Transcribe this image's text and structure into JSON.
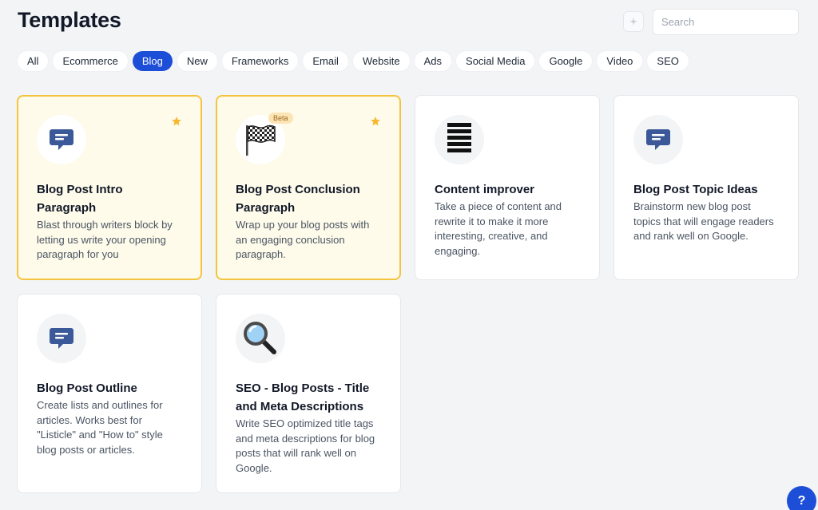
{
  "header": {
    "title": "Templates",
    "search_placeholder": "Search"
  },
  "filters": [
    "All",
    "Ecommerce",
    "Blog",
    "New",
    "Frameworks",
    "Email",
    "Website",
    "Ads",
    "Social Media",
    "Google",
    "Video",
    "SEO"
  ],
  "active_filter": "Blog",
  "cards": [
    {
      "title": "Blog Post Intro Paragraph",
      "description": "Blast through writers block by letting us write your opening paragraph for you",
      "icon": "speech-bubble-icon",
      "favorite": true,
      "highlighted": true
    },
    {
      "title": "Blog Post Conclusion Paragraph",
      "description": "Wrap up your blog posts with an engaging conclusion paragraph.",
      "icon": "checkered-flag-icon",
      "favorite": true,
      "highlighted": true,
      "badge": "Beta"
    },
    {
      "title": "Content improver",
      "description": "Take a piece of content and rewrite it to make it more interesting, creative, and engaging.",
      "icon": "text-lines-icon",
      "favorite": false,
      "highlighted": false
    },
    {
      "title": "Blog Post Topic Ideas",
      "description": "Brainstorm new blog post topics that will engage readers and rank well on Google.",
      "icon": "speech-bubble-icon",
      "favorite": false,
      "highlighted": false
    },
    {
      "title": "Blog Post Outline",
      "description": "Create lists and outlines for articles. Works best for \"Listicle\" and \"How to\" style blog posts or articles.",
      "icon": "speech-bubble-icon",
      "favorite": false,
      "highlighted": false
    },
    {
      "title": "SEO - Blog Posts - Title and Meta Descriptions",
      "description": "Write SEO optimized title tags and meta descriptions for blog posts that will rank well on Google.",
      "icon": "magnifying-glass-icon",
      "favorite": false,
      "highlighted": false
    }
  ],
  "help_label": "?",
  "colors": {
    "accent": "#1d4ed8",
    "highlight_bg": "#fefbea",
    "highlight_border": "#f5c43e",
    "star": "#f5b82e",
    "icon_blue": "#3b5998"
  }
}
